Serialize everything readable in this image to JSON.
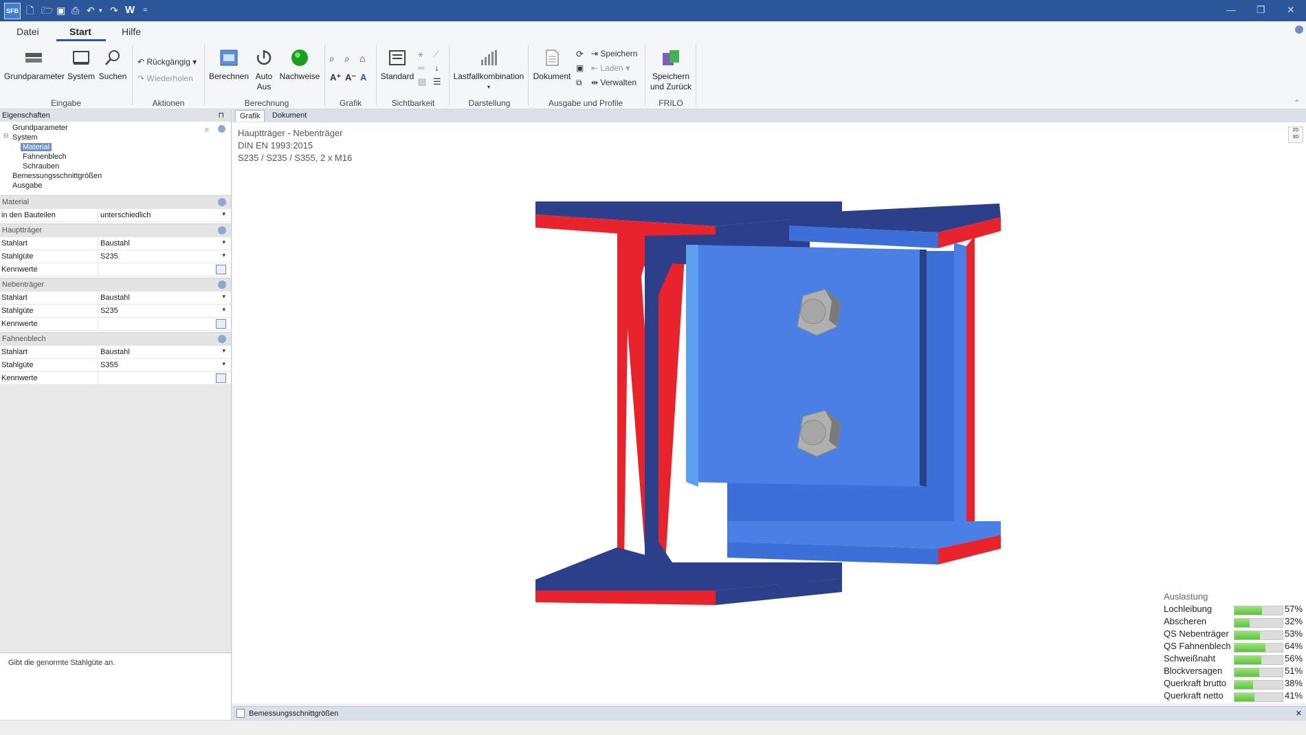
{
  "app": {
    "icon_text": "SFB",
    "qa_word": "W",
    "customize": "="
  },
  "menu": {
    "tabs": [
      {
        "label": "Datei"
      },
      {
        "label": "Start"
      },
      {
        "label": "Hilfe"
      }
    ]
  },
  "ribbon": {
    "eingabe": {
      "label": "Eingabe",
      "grundparameter": "Grundparameter",
      "system": "System",
      "suchen": "Suchen"
    },
    "aktionen": {
      "label": "Aktionen",
      "undo": "Rückgängig",
      "redo": "Wiederholen"
    },
    "berechnung": {
      "label": "Berechnung",
      "berechnen": "Berechnen",
      "auto": "Auto",
      "aus": "Aus",
      "nachweise": "Nachweise"
    },
    "grafik": {
      "label": "Grafik"
    },
    "sichtbarkeit": {
      "label": "Sichtbarkeit",
      "standard": "Standard"
    },
    "darstellung": {
      "label": "Darstellung",
      "lastfall": "Lastfallkombination"
    },
    "ausgabe": {
      "label": "Ausgabe und Profile",
      "dokument": "Dokument",
      "speichern": "Speichern",
      "laden": "Laden",
      "verwalten": "Verwalten"
    },
    "frilo": {
      "label": "FRILO",
      "line1": "Speichern",
      "line2": "und Zurück"
    }
  },
  "panel": {
    "title": "Eigenschaften",
    "pin": "⊓",
    "tree": [
      {
        "label": "Grundparameter"
      },
      {
        "label": "System"
      },
      {
        "label": "Material"
      },
      {
        "label": "Fahnenblech"
      },
      {
        "label": "Schrauben"
      },
      {
        "label": "Bemessungsschnittgrößen"
      },
      {
        "label": "Ausgabe"
      }
    ],
    "sections": {
      "material": {
        "title": "Material",
        "row_label": "in den Bauteilen",
        "row_value": "unterschiedlich"
      },
      "haupttraeger": {
        "title": "Hauptträger",
        "stahlart": "Stahlart",
        "stahlart_val": "Baustahl",
        "stahlguete": "Stahlgüte",
        "stahlguete_val": "S235",
        "kennwerte": "Kennwerte"
      },
      "nebentraeger": {
        "title": "Nebenträger",
        "stahlart": "Stahlart",
        "stahlart_val": "Baustahl",
        "stahlguete": "Stahlgüte",
        "stahlguete_val": "S235",
        "kennwerte": "Kennwerte"
      },
      "fahnenblech": {
        "title": "Fahnenblech",
        "stahlart": "Stahlart",
        "stahlart_val": "Baustahl",
        "stahlguete": "Stahlgüte",
        "stahlguete_val": "S355",
        "kennwerte": "Kennwerte"
      }
    },
    "hint": "Gibt die genormte Stahlgüte an."
  },
  "doctabs": [
    {
      "label": "Grafik"
    },
    {
      "label": "Dokument"
    }
  ],
  "canvas": {
    "line1": "Hauptträger - Nebenträger",
    "line2": "DIN EN 1993:2015",
    "line3": "S235 / S235 / S355,  2 x M16",
    "toggle_2d": "2D",
    "toggle_3d": "3D"
  },
  "utilization": {
    "title": "Auslastung",
    "items": [
      {
        "label": "Lochleibung",
        "value": 0.57,
        "text": "57%"
      },
      {
        "label": "Abscheren",
        "value": 0.32,
        "text": "32%"
      },
      {
        "label": "QS Nebenträger",
        "value": 0.53,
        "text": "53%"
      },
      {
        "label": "QS Fahnenblech",
        "value": 0.64,
        "text": "64%"
      },
      {
        "label": "Schweißnaht",
        "value": 0.56,
        "text": "56%"
      },
      {
        "label": "Blockversagen",
        "value": 0.51,
        "text": "51%"
      },
      {
        "label": "Querkraft brutto",
        "value": 0.38,
        "text": "38%"
      },
      {
        "label": "Querkraft netto",
        "value": 0.41,
        "text": "41%"
      }
    ]
  },
  "bottom_panel": {
    "label": "Bemessungsschnittgrößen",
    "close": "✕"
  },
  "colors": {
    "title_bar": "#2b579a",
    "section_red": "#e8232b",
    "beam_dark": "#2b3f8a",
    "beam_blue": "#3d6fd8",
    "plate_blue": "#4a7fe6",
    "bolt": "#9a9a9a"
  }
}
